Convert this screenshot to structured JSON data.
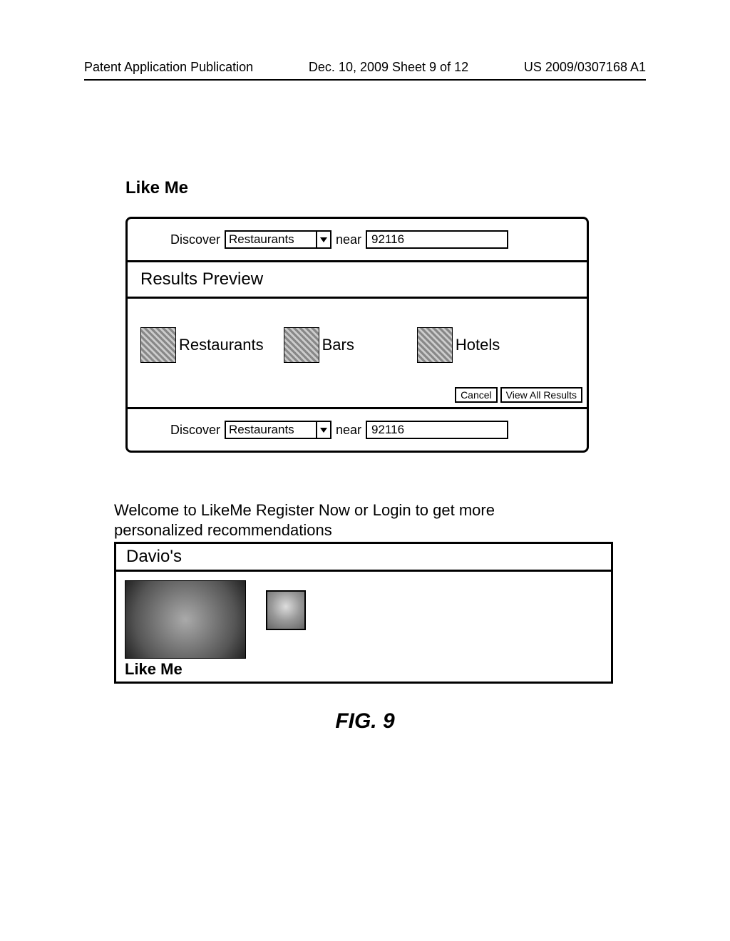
{
  "header": {
    "left": "Patent Application Publication",
    "center": "Dec. 10, 2009  Sheet 9 of 12",
    "right": "US 2009/0307168 A1"
  },
  "app": {
    "title": "Like Me"
  },
  "search1": {
    "discover_label": "Discover",
    "category_value": "Restaurants",
    "near_label": "near",
    "location_value": "92116"
  },
  "results": {
    "heading": "Results Preview",
    "categories": [
      {
        "label": "Restaurants",
        "icon": "restaurant-thumb"
      },
      {
        "label": "Bars",
        "icon": "bars-thumb"
      },
      {
        "label": "Hotels",
        "icon": "hotels-thumb"
      }
    ],
    "cancel_label": "Cancel",
    "view_all_label": "View All Results"
  },
  "search2": {
    "discover_label": "Discover",
    "category_value": "Restaurants",
    "near_label": "near",
    "location_value": "92116"
  },
  "welcome": {
    "text": "Welcome to LikeMe  Register Now or Login to get more personalized recommendations"
  },
  "result_card": {
    "name": "Davio's",
    "like_me_label": "Like Me"
  },
  "figure": {
    "caption": "FIG. 9"
  }
}
